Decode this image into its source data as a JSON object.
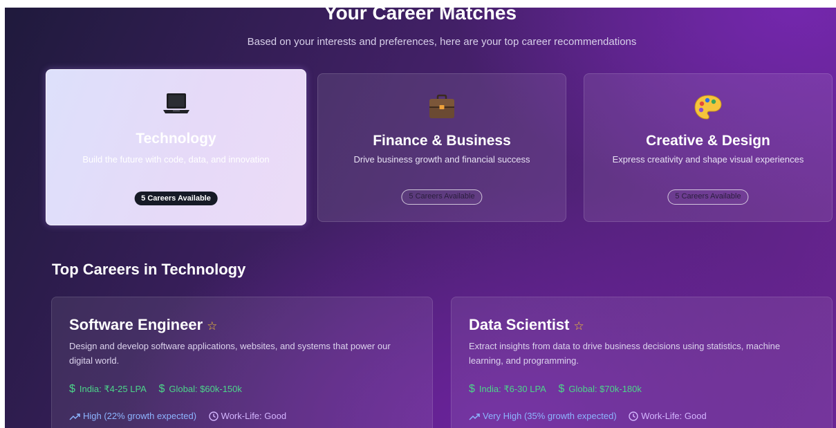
{
  "header": {
    "title": "Your Career Matches",
    "subtitle": "Based on your interests and preferences, here are your top career recommendations"
  },
  "categories": [
    {
      "icon": "laptop-icon",
      "name": "Technology",
      "description": "Build the future with code, data, and innovation",
      "badge": "5 Careers Available",
      "selected": true
    },
    {
      "icon": "briefcase-icon",
      "name": "Finance & Business",
      "description": "Drive business growth and financial success",
      "badge": "5 Careers Available",
      "selected": false
    },
    {
      "icon": "palette-icon",
      "name": "Creative & Design",
      "description": "Express creativity and shape visual experiences",
      "badge": "5 Careers Available",
      "selected": false
    }
  ],
  "section": {
    "title": "Top Careers in Technology"
  },
  "careers": [
    {
      "title": "Software Engineer",
      "description": "Design and develop software applications, websites, and systems that power our digital world.",
      "salary_india": "India: ₹4-25 LPA",
      "salary_global": "Global: $60k-150k",
      "growth": "High (22% growth expected)",
      "work_life": "Work-Life: Good"
    },
    {
      "title": "Data Scientist",
      "description": "Extract insights from data to drive business decisions using statistics, machine learning, and programming.",
      "salary_india": "India: ₹6-30 LPA",
      "salary_global": "Global: $70k-180k",
      "growth": "Very High (35% growth expected)",
      "work_life": "Work-Life: Good"
    }
  ],
  "colors": {
    "salary": "#4cd68a",
    "growth": "#8db5ff",
    "work_life": "#d4b6ff",
    "star": "#f3c431"
  }
}
